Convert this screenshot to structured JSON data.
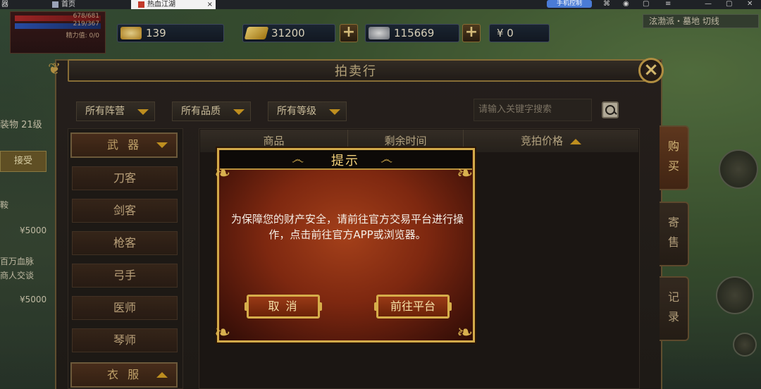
{
  "browser": {
    "tab_home_prefix": "器",
    "tab_home": "首页",
    "tab_game": "热血江湖",
    "tab_close": "×",
    "assist_label": "手机控制"
  },
  "hud": {
    "hp_line1": "678/681",
    "hp_line2": "219/367",
    "hp_line3": "精力值: 0/0",
    "currency": [
      {
        "icon": "gold-ingot-icon",
        "value": "139"
      },
      {
        "icon": "gold-bars-icon",
        "value": "31200"
      },
      {
        "icon": "silver-ingot-icon",
        "value": "115669"
      },
      {
        "icon": "yuan-icon",
        "value": "¥  0"
      }
    ],
    "location": "泫渤派・墓地   切线",
    "left_text_1": "装物 21级",
    "left_text_2": "鞍",
    "left_price_1": "¥5000",
    "left_text_3": "百万血脉",
    "left_text_4": "商人交谈",
    "left_price_2": "¥5000",
    "left_btn": "接受"
  },
  "panel": {
    "title": "拍卖行",
    "close": "×",
    "filters": [
      "所有阵营",
      "所有品质",
      "所有等级"
    ],
    "search_placeholder": "请输入关键字搜索",
    "categories": {
      "weapon_header": "武 器",
      "items": [
        "刀客",
        "剑客",
        "枪客",
        "弓手",
        "医师",
        "琴师"
      ],
      "armor_header": "衣 服"
    },
    "columns": [
      "商品",
      "剩余时间",
      "竞拍价格"
    ],
    "side_tabs": [
      "购买",
      "寄售",
      "记录"
    ]
  },
  "modal": {
    "title": "提示",
    "message": "为保障您的财产安全，请前往官方交易平台进行操作，点击前往官方APP或浏览器。",
    "cancel": "取 消",
    "confirm": "前往平台"
  },
  "colors": {
    "gold": "#d2aa4a",
    "modal_red": "#7e2810",
    "panel_bg": "#231e1a"
  }
}
